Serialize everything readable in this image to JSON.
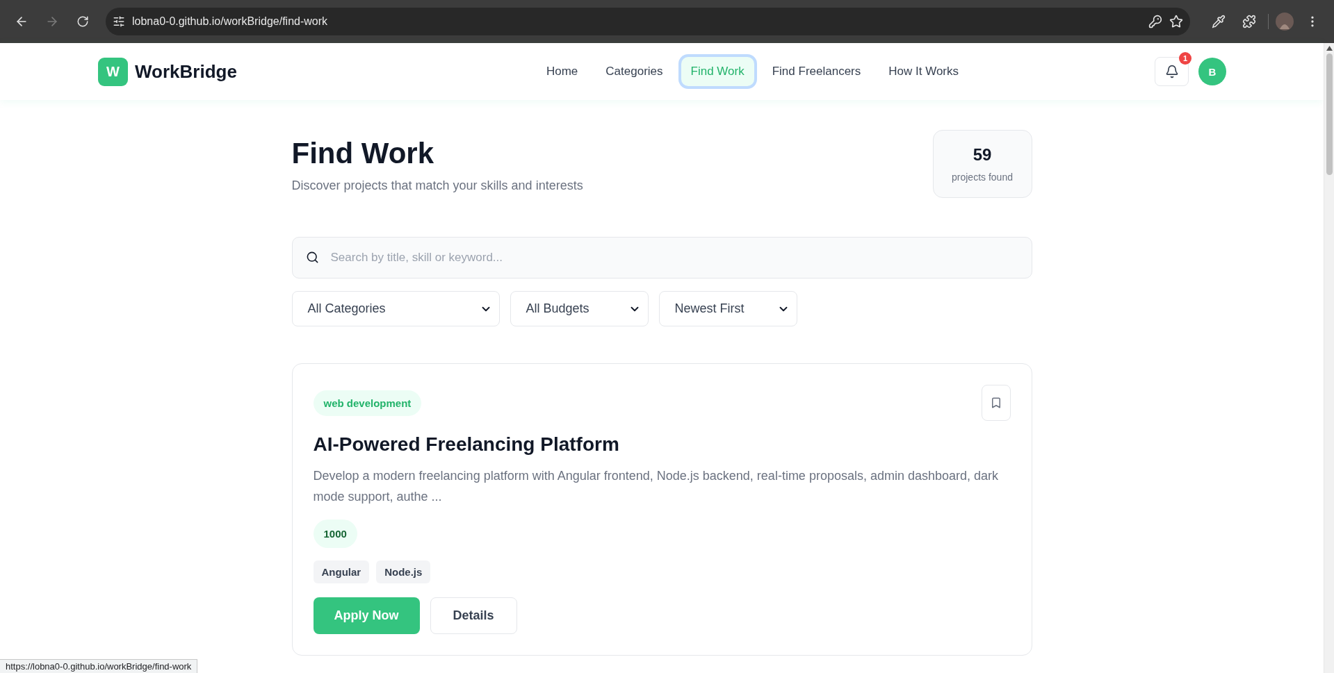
{
  "browser": {
    "url": "lobna0-0.github.io/workBridge/find-work",
    "forward_disabled": true
  },
  "header": {
    "logo_letter": "W",
    "brand": "WorkBridge",
    "nav": [
      {
        "label": "Home",
        "selected": false
      },
      {
        "label": "Categories",
        "selected": false
      },
      {
        "label": "Find Work",
        "selected": true
      },
      {
        "label": "Find Freelancers",
        "selected": false
      },
      {
        "label": "How It Works",
        "selected": false
      }
    ],
    "notification_count": "1",
    "avatar_letter": "B"
  },
  "page": {
    "title": "Find Work",
    "subtitle": "Discover projects that match your skills and interests",
    "stats": {
      "count": "59",
      "label": "projects found"
    },
    "search": {
      "placeholder": "Search by title, skill or keyword..."
    },
    "filters": [
      {
        "value": "All Categories"
      },
      {
        "value": "All Budgets"
      },
      {
        "value": "Newest First"
      }
    ],
    "projects": [
      {
        "category": "web development",
        "title": "AI-Powered Freelancing Platform",
        "description": "Develop a modern freelancing platform with Angular frontend, Node.js backend, real-time proposals, admin dashboard, dark mode support, authe ...",
        "budget": "1000",
        "skills": [
          "Angular",
          "Node.js"
        ],
        "primary_action": "Apply Now",
        "secondary_action": "Details"
      }
    ]
  },
  "status_link": "https://lobna0-0.github.io/workBridge/find-work"
}
